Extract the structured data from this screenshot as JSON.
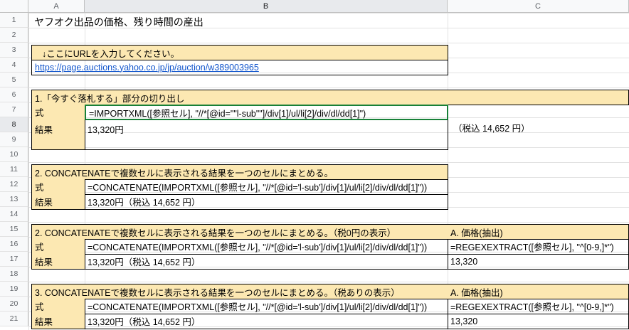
{
  "columns": [
    "A",
    "B",
    "C"
  ],
  "rows": [
    "1",
    "2",
    "3",
    "4",
    "5",
    "6",
    "7",
    "8",
    "9",
    "10",
    "11",
    "12",
    "13",
    "14",
    "15",
    "16",
    "17",
    "18",
    "19",
    "20",
    "21"
  ],
  "title": "ヤフオク出品の価格、残り時間の産出",
  "url_prompt": "↓ここにURLを入力してください。",
  "url": "https://page.auctions.yahoo.co.jp/jp/auction/w389003965",
  "s1": {
    "heading": "1.「今すぐ落札する」部分の切り出し",
    "label_formula": "式",
    "formula": "=IMPORTXML([参照セル], \"//*[@id=\"\"l-sub\"\"]/div[1]/ul/li[2]/div/dl/dd[1]\")",
    "label_result": "結果",
    "result": "13,320円",
    "result_c": "（税込 14,652 円）"
  },
  "s2": {
    "heading": "2. CONCATENATEで複数セルに表示される結果を一つのセルにまとめる。",
    "label_formula": "式",
    "formula": "=CONCATENATE(IMPORTXML([参照セル], \"//*[@id='l-sub']/div[1]/ul/li[2]/div/dl/dd[1]\"))",
    "label_result": "結果",
    "result": "13,320円（税込 14,652 円）"
  },
  "s3": {
    "heading": "2. CONCATENATEで複数セルに表示される結果を一つのセルにまとめる。（税0円の表示）",
    "heading_c": "A. 価格(抽出)",
    "label_formula": "式",
    "formula": "=CONCATENATE(IMPORTXML([参照セル], \"//*[@id='l-sub']/div[1]/ul/li[2]/div/dl/dd[1]\"))",
    "formula_c": "=REGEXEXTRACT([参照セル], \"^[0-9,]*\")",
    "label_result": "結果",
    "result": "13,320円（税込 14,652 円）",
    "result_c": "13,320"
  },
  "s4": {
    "heading": "3. CONCATENATEで複数セルに表示される結果を一つのセルにまとめる。（税ありの表示）",
    "heading_c": "A. 価格(抽出)",
    "label_formula": "式",
    "formula": "=CONCATENATE(IMPORTXML([参照セル], \"//*[@id='l-sub']/div[1]/ul/li[2]/div/dl/dd[1]\"))",
    "formula_c": "=REGEXEXTRACT([参照セル], \"^[0-9,]*\")",
    "label_result": "結果",
    "result": "13,320円（税込 14,652 円）",
    "result_c": "13,320"
  },
  "colors": {
    "header_fill": "#fce8b2",
    "link": "#1155cc",
    "selection": "#188038"
  }
}
